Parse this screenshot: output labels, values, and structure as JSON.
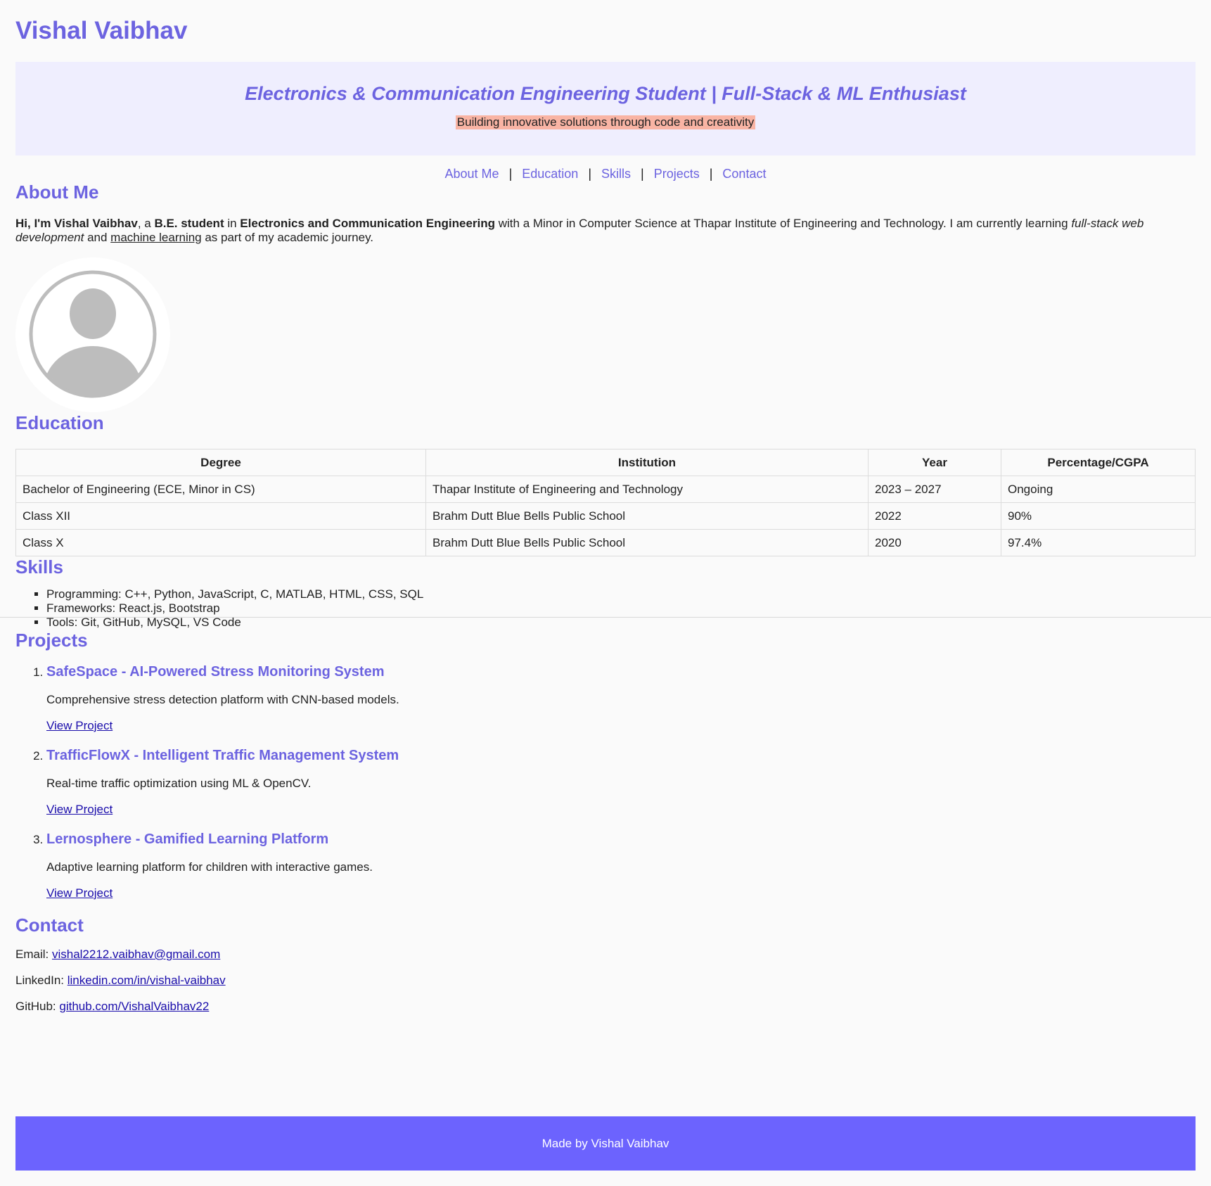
{
  "header": {
    "title": "Vishal Vaibhav"
  },
  "hero": {
    "heading": "Electronics & Communication Engineering Student | Full-Stack & ML Enthusiast",
    "tagline": "Building innovative solutions through code and creativity"
  },
  "nav": {
    "items": [
      "About Me",
      "Education",
      "Skills",
      "Projects",
      "Contact"
    ],
    "separator": "|"
  },
  "about": {
    "title": "About Me",
    "greeting": "Hi, I'm Vishal Vaibhav",
    "t1": ", a ",
    "degree": "B.E. student",
    "t2": " in ",
    "branch": "Electronics and Communication Engineering",
    "t3": " with a Minor in Computer Science at Thapar Institute of Engineering and Technology. I am currently learning ",
    "fullstack": "full-stack web development",
    "t4": " and ",
    "ml": "machine learning",
    "t5": " as part of my academic journey.",
    "avatar_icon": "user-avatar-icon"
  },
  "education": {
    "title": "Education",
    "headers": [
      "Degree",
      "Institution",
      "Year",
      "Percentage/CGPA"
    ],
    "rows": [
      [
        "Bachelor of Engineering (ECE, Minor in CS)",
        "Thapar Institute of Engineering and Technology",
        "2023 – 2027",
        "Ongoing"
      ],
      [
        "Class XII",
        "Brahm Dutt Blue Bells Public School",
        "2022",
        "90%"
      ],
      [
        "Class X",
        "Brahm Dutt Blue Bells Public School",
        "2020",
        "97.4%"
      ]
    ]
  },
  "skills": {
    "title": "Skills",
    "items": [
      "Programming: C++, Python, JavaScript, C, MATLAB, HTML, CSS, SQL",
      "Frameworks: React.js, Bootstrap",
      "Tools: Git, GitHub, MySQL, VS Code"
    ]
  },
  "projects": {
    "title": "Projects",
    "items": [
      {
        "name": "SafeSpace - AI-Powered Stress Monitoring System",
        "desc": "Comprehensive stress detection platform with CNN-based models.",
        "link": "View Project"
      },
      {
        "name": "TrafficFlowX - Intelligent Traffic Management System",
        "desc": "Real-time traffic optimization using ML & OpenCV.",
        "link": "View Project"
      },
      {
        "name": "Lernosphere - Gamified Learning Platform",
        "desc": "Adaptive learning platform for children with interactive games.",
        "link": "View Project"
      }
    ]
  },
  "contact": {
    "title": "Contact",
    "email_label": "Email: ",
    "email": "vishal2212.vaibhav@gmail.com",
    "linkedin_label": "LinkedIn: ",
    "linkedin": "linkedin.com/in/vishal-vaibhav",
    "github_label": "GitHub: ",
    "github": "github.com/VishalVaibhav22"
  },
  "footer": {
    "text": "Made by Vishal Vaibhav"
  },
  "colors": {
    "accent": "#6c63e0",
    "hero_bg": "#efeefe",
    "highlight": "#f9b4a4",
    "footer_bg": "#6c63fe",
    "link": "#1a0dab"
  }
}
